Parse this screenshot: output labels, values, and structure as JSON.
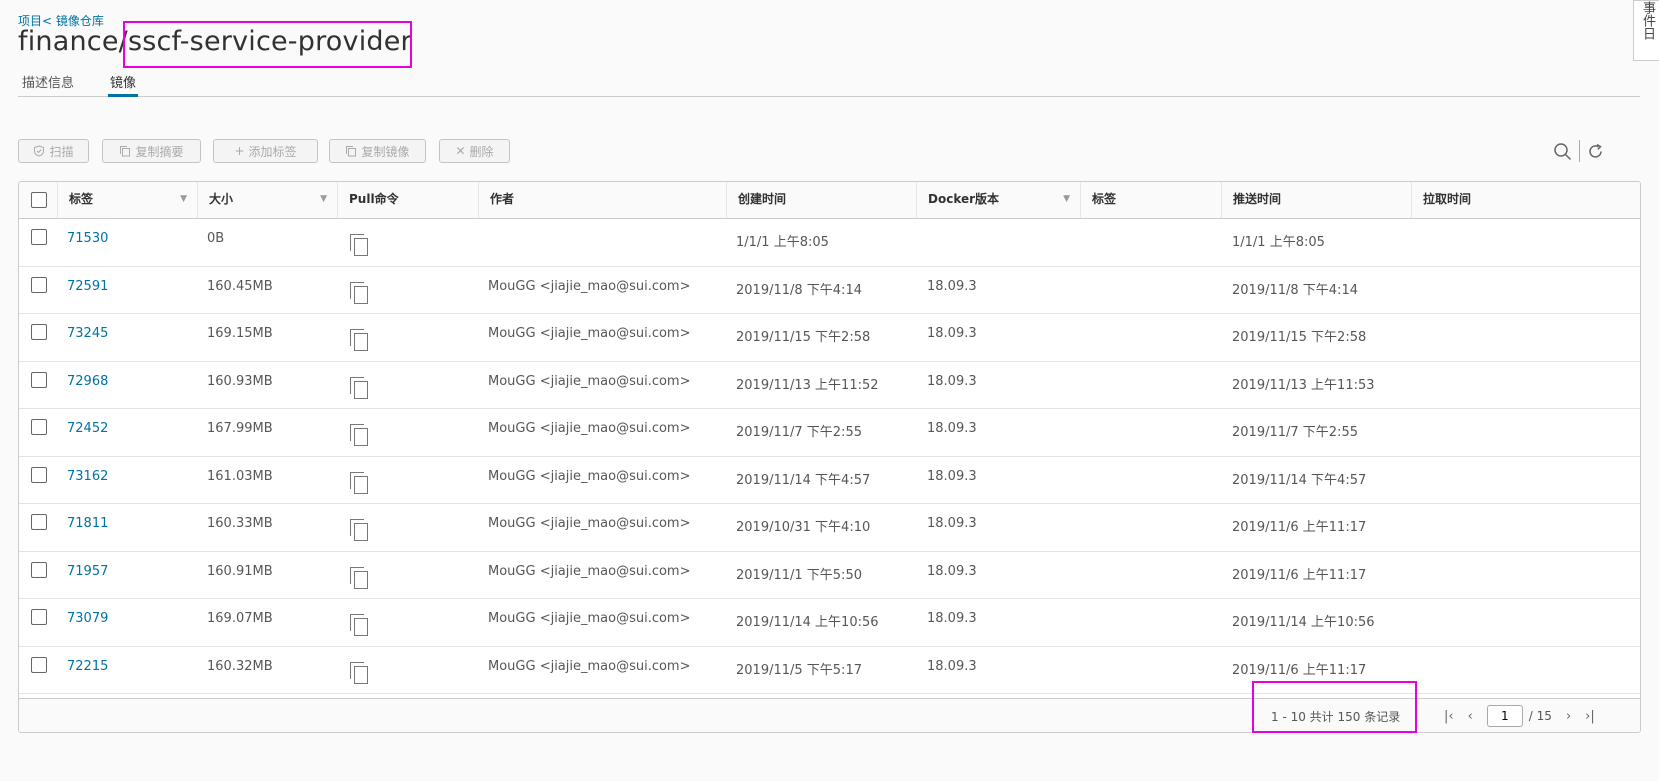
{
  "breadcrumb": {
    "projects": "项目",
    "sep": "<",
    "repo": "镜像仓库"
  },
  "title": {
    "prefix": "finance/",
    "repo": "sscf-service-provider"
  },
  "tabs": [
    {
      "label": "描述信息"
    },
    {
      "label": "镜像"
    }
  ],
  "side_tab": {
    "label": "事件日"
  },
  "toolbar": {
    "scan": "扫描",
    "copy_digest": "复制摘要",
    "add_label": "添加标签",
    "copy_image": "复制镜像",
    "delete": "删除"
  },
  "columns": {
    "tag": "标签",
    "size": "大小",
    "pull": "Pull命令",
    "author": "作者",
    "created": "创建时间",
    "docker": "Docker版本",
    "labels": "标签",
    "pushed": "推送时间",
    "pulled": "拉取时间"
  },
  "rows": [
    {
      "tag": "71530",
      "size": "0B",
      "author": "",
      "created": "1/1/1 上午8:05",
      "docker": "",
      "pushed": "1/1/1 上午8:05"
    },
    {
      "tag": "72591",
      "size": "160.45MB",
      "author": "MouGG <jiajie_mao@sui.com>",
      "created": "2019/11/8 下午4:14",
      "docker": "18.09.3",
      "pushed": "2019/11/8 下午4:14"
    },
    {
      "tag": "73245",
      "size": "169.15MB",
      "author": "MouGG <jiajie_mao@sui.com>",
      "created": "2019/11/15 下午2:58",
      "docker": "18.09.3",
      "pushed": "2019/11/15 下午2:58"
    },
    {
      "tag": "72968",
      "size": "160.93MB",
      "author": "MouGG <jiajie_mao@sui.com>",
      "created": "2019/11/13 上午11:52",
      "docker": "18.09.3",
      "pushed": "2019/11/13 上午11:53"
    },
    {
      "tag": "72452",
      "size": "167.99MB",
      "author": "MouGG <jiajie_mao@sui.com>",
      "created": "2019/11/7 下午2:55",
      "docker": "18.09.3",
      "pushed": "2019/11/7 下午2:55"
    },
    {
      "tag": "73162",
      "size": "161.03MB",
      "author": "MouGG <jiajie_mao@sui.com>",
      "created": "2019/11/14 下午4:57",
      "docker": "18.09.3",
      "pushed": "2019/11/14 下午4:57"
    },
    {
      "tag": "71811",
      "size": "160.33MB",
      "author": "MouGG <jiajie_mao@sui.com>",
      "created": "2019/10/31 下午4:10",
      "docker": "18.09.3",
      "pushed": "2019/11/6 上午11:17"
    },
    {
      "tag": "71957",
      "size": "160.91MB",
      "author": "MouGG <jiajie_mao@sui.com>",
      "created": "2019/11/1 下午5:50",
      "docker": "18.09.3",
      "pushed": "2019/11/6 上午11:17"
    },
    {
      "tag": "73079",
      "size": "169.07MB",
      "author": "MouGG <jiajie_mao@sui.com>",
      "created": "2019/11/14 上午10:56",
      "docker": "18.09.3",
      "pushed": "2019/11/14 上午10:56"
    },
    {
      "tag": "72215",
      "size": "160.32MB",
      "author": "MouGG <jiajie_mao@sui.com>",
      "created": "2019/11/5 下午5:17",
      "docker": "18.09.3",
      "pushed": "2019/11/6 上午11:17"
    }
  ],
  "footer": {
    "summary": "1 - 10 共计 150 条记录",
    "page": "1",
    "total_pages": "/ 15"
  },
  "colors": {
    "link": "#0072a3",
    "highlight": "#e600e6"
  }
}
